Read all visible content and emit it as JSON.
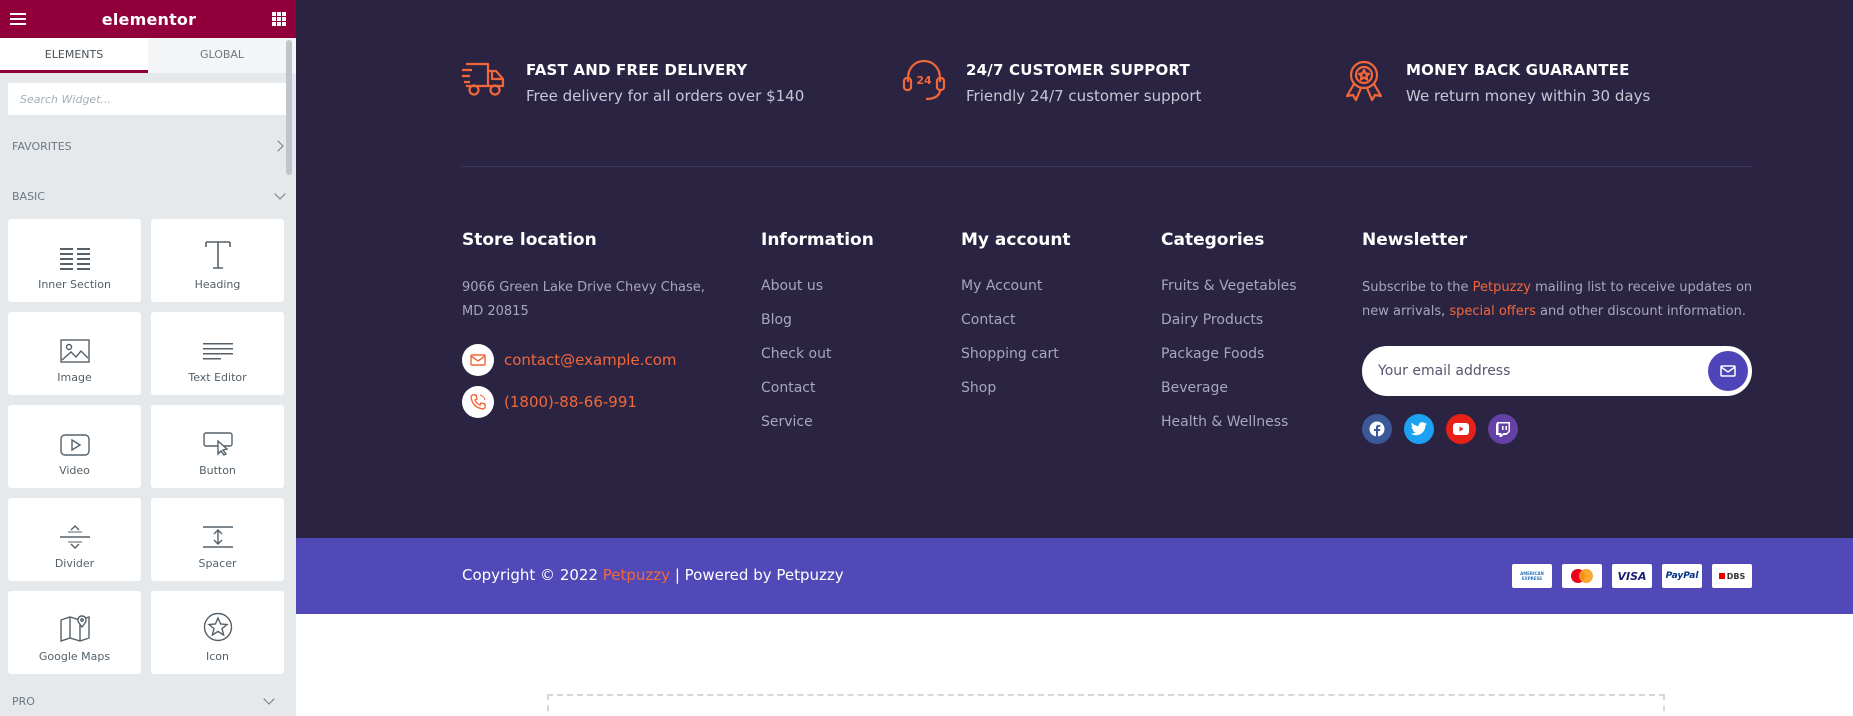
{
  "panel": {
    "brand": "elementor",
    "tabs": [
      {
        "label": "ELEMENTS"
      },
      {
        "label": "GLOBAL"
      }
    ],
    "search_placeholder": "Search Widget...",
    "categories": {
      "favorites": "FAVORITES",
      "basic": "BASIC",
      "pro": "PRO"
    },
    "widgets": [
      {
        "label": "Inner Section",
        "icon": "inner-section-icon"
      },
      {
        "label": "Heading",
        "icon": "heading-icon"
      },
      {
        "label": "Image",
        "icon": "image-icon"
      },
      {
        "label": "Text Editor",
        "icon": "text-editor-icon"
      },
      {
        "label": "Video",
        "icon": "video-icon"
      },
      {
        "label": "Button",
        "icon": "button-icon"
      },
      {
        "label": "Divider",
        "icon": "divider-icon"
      },
      {
        "label": "Spacer",
        "icon": "spacer-icon"
      },
      {
        "label": "Google Maps",
        "icon": "google-maps-icon"
      },
      {
        "label": "Icon",
        "icon": "star-icon"
      }
    ]
  },
  "features": [
    {
      "title": "FAST AND FREE DELIVERY",
      "text": "Free delivery for all orders over $140",
      "icon": "delivery-truck-icon"
    },
    {
      "title": "24/7 CUSTOMER SUPPORT",
      "text": "Friendly 24/7 customer support",
      "icon": "headset-24-icon"
    },
    {
      "title": "MONEY BACK GUARANTEE",
      "text": "We return money within 30 days",
      "icon": "award-badge-icon"
    }
  ],
  "store": {
    "title": "Store location",
    "address": "9066 Green Lake Drive Chevy Chase, MD 20815",
    "email": "contact@example.com",
    "phone": "(1800)-88-66-991"
  },
  "information": {
    "title": "Information",
    "links": [
      "About us",
      "Blog",
      "Check out",
      "Contact",
      "Service"
    ]
  },
  "account": {
    "title": "My account",
    "links": [
      "My Account",
      "Contact",
      "Shopping cart",
      "Shop"
    ]
  },
  "categories": {
    "title": "Categories",
    "links": [
      "Fruits & Vegetables",
      "Dairy Products",
      "Package Foods",
      "Beverage",
      "Health & Wellness"
    ]
  },
  "newsletter": {
    "title": "Newsletter",
    "text_1": "Subscribe to the ",
    "brand": "Petpuzzy",
    "text_2": " mailing list to receive updates on new arrivals, ",
    "offers": "special offers",
    "text_3": " and other discount information.",
    "email_placeholder": "Your email address"
  },
  "socials": [
    {
      "name": "facebook-icon",
      "color": "#3b5998"
    },
    {
      "name": "twitter-icon",
      "color": "#1da1f2"
    },
    {
      "name": "youtube-icon",
      "color": "#e62117"
    },
    {
      "name": "twitch-icon",
      "color": "#6441a5"
    }
  ],
  "copyright": {
    "prefix": "Copyright © 2022 ",
    "brand": "Petpuzzy",
    "suffix": " | Powered by Petpuzzy"
  },
  "payments": [
    {
      "label": "AMERICAN EXPRESS",
      "icon": "amex-icon"
    },
    {
      "label": "",
      "icon": "mastercard-icon"
    },
    {
      "label": "VISA",
      "icon": "visa-icon"
    },
    {
      "label": "PayPal",
      "icon": "paypal-icon"
    },
    {
      "label": "DBS",
      "icon": "dbs-icon"
    }
  ],
  "colors": {
    "accent": "#f2673a",
    "footer_bg": "#2a2442",
    "bottom_bg": "#5149b8",
    "panel_brand": "#92003b"
  }
}
